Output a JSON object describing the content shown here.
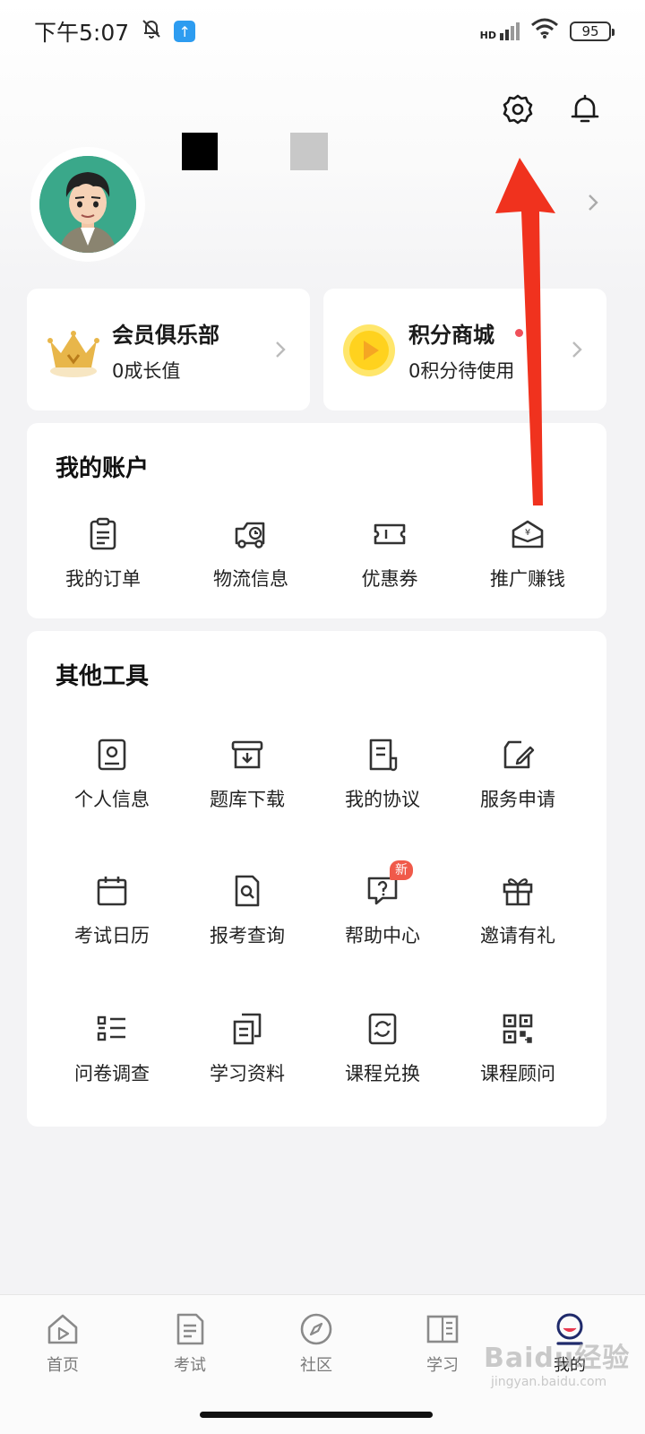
{
  "status_bar": {
    "time": "下午5:07",
    "network": "HD",
    "battery": "95"
  },
  "header": {
    "settings_icon": "gear-icon",
    "notification_icon": "bell-icon"
  },
  "profile": {
    "avatar_icon": "cartoon-avatar"
  },
  "member_club": {
    "title": "会员俱乐部",
    "subtitle": "0成长值"
  },
  "points_mall": {
    "title": "积分商城",
    "subtitle": "0积分待使用"
  },
  "account": {
    "title": "我的账户",
    "items": [
      {
        "label": "我的订单",
        "icon": "order-clipboard-icon"
      },
      {
        "label": "物流信息",
        "icon": "delivery-truck-icon"
      },
      {
        "label": "优惠券",
        "icon": "coupon-icon"
      },
      {
        "label": "推广赚钱",
        "icon": "promote-earn-icon"
      }
    ]
  },
  "tools": {
    "title": "其他工具",
    "items": [
      {
        "label": "个人信息",
        "icon": "profile-card-icon"
      },
      {
        "label": "题库下载",
        "icon": "download-box-icon"
      },
      {
        "label": "我的协议",
        "icon": "agreement-doc-icon"
      },
      {
        "label": "服务申请",
        "icon": "edit-note-icon"
      },
      {
        "label": "考试日历",
        "icon": "calendar-icon"
      },
      {
        "label": "报考查询",
        "icon": "search-doc-icon"
      },
      {
        "label": "帮助中心",
        "icon": "help-chat-icon",
        "badge": "新"
      },
      {
        "label": "邀请有礼",
        "icon": "gift-icon"
      },
      {
        "label": "问卷调查",
        "icon": "list-icon"
      },
      {
        "label": "学习资料",
        "icon": "copy-docs-icon"
      },
      {
        "label": "课程兑换",
        "icon": "exchange-icon"
      },
      {
        "label": "课程顾问",
        "icon": "qr-code-icon"
      }
    ]
  },
  "tab_bar": {
    "items": [
      {
        "label": "首页",
        "icon": "home-icon"
      },
      {
        "label": "考试",
        "icon": "exam-doc-icon"
      },
      {
        "label": "社区",
        "icon": "compass-icon"
      },
      {
        "label": "学习",
        "icon": "book-icon"
      },
      {
        "label": "我的",
        "icon": "user-icon"
      }
    ],
    "active_index": 4
  },
  "watermark": {
    "text": "Baidu经验",
    "sub": "jingyan.baidu.com"
  },
  "colors": {
    "accent_red": "#f0505a",
    "arrow_red": "#f0321e",
    "avatar_bg": "#3aa88a",
    "crown_gold": "#e8b64a",
    "coin_yellow": "#ffd21e"
  }
}
